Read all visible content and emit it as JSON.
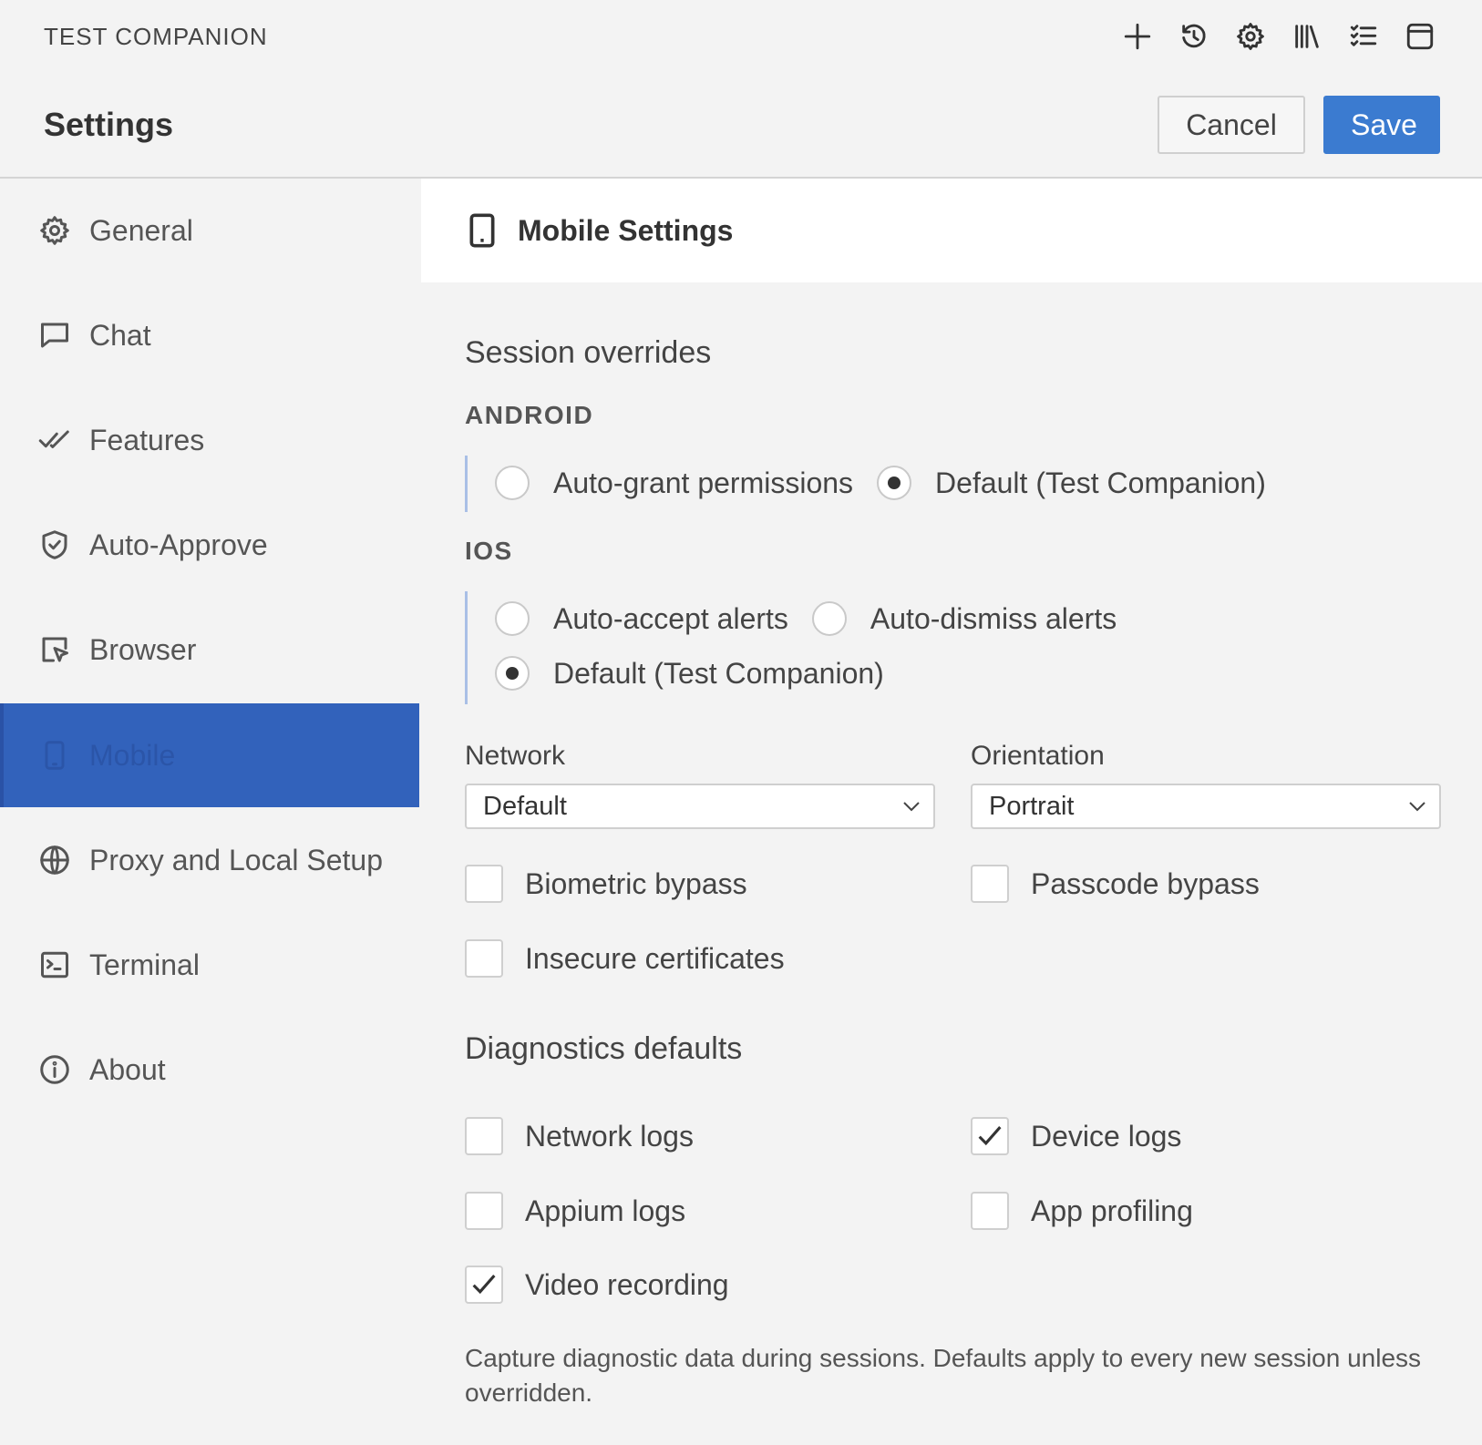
{
  "app": {
    "title": "TEST COMPANION"
  },
  "toolbar": {
    "icons": [
      "plus-icon",
      "history-icon",
      "gear-icon",
      "library-icon",
      "checklist-icon",
      "window-icon"
    ]
  },
  "header": {
    "title": "Settings",
    "cancel_label": "Cancel",
    "save_label": "Save"
  },
  "sidebar": {
    "items": [
      {
        "label": "General",
        "icon": "gear-icon"
      },
      {
        "label": "Chat",
        "icon": "chat-bubble-icon"
      },
      {
        "label": "Features",
        "icon": "double-check-icon"
      },
      {
        "label": "Auto-Approve",
        "icon": "shield-check-icon"
      },
      {
        "label": "Browser",
        "icon": "browser-cursor-icon"
      },
      {
        "label": "Mobile",
        "icon": "mobile-icon",
        "active": true
      },
      {
        "label": "Proxy and Local Setup",
        "icon": "globe-icon"
      },
      {
        "label": "Terminal",
        "icon": "terminal-icon"
      },
      {
        "label": "About",
        "icon": "info-icon"
      }
    ]
  },
  "main": {
    "title": "Mobile Settings",
    "session_overrides": {
      "title": "Session overrides",
      "android": {
        "label": "ANDROID",
        "options": [
          {
            "label": "Auto-grant permissions",
            "selected": false
          },
          {
            "label": "Default (Test Companion)",
            "selected": true
          }
        ]
      },
      "ios": {
        "label": "IOS",
        "options": [
          {
            "label": "Auto-accept alerts",
            "selected": false
          },
          {
            "label": "Auto-dismiss alerts",
            "selected": false
          },
          {
            "label": "Default (Test Companion)",
            "selected": true
          }
        ]
      },
      "network": {
        "label": "Network",
        "value": "Default"
      },
      "orientation": {
        "label": "Orientation",
        "value": "Portrait"
      },
      "checks": [
        {
          "label": "Biometric bypass",
          "checked": false
        },
        {
          "label": "Passcode bypass",
          "checked": false
        },
        {
          "label": "Insecure certificates",
          "checked": false
        }
      ]
    },
    "diagnostics": {
      "title": "Diagnostics defaults",
      "checks": [
        {
          "label": "Network logs",
          "checked": false
        },
        {
          "label": "Device logs",
          "checked": true
        },
        {
          "label": "Appium logs",
          "checked": false
        },
        {
          "label": "App profiling",
          "checked": false
        },
        {
          "label": "Video recording",
          "checked": true
        }
      ],
      "help": "Capture diagnostic data during sessions. Defaults apply to every new session unless overridden."
    }
  },
  "colors": {
    "accent": "#3b7bd0",
    "sidebar_active": "#3262bb",
    "group_rule": "#a9bfe6",
    "background": "#f3f3f3"
  }
}
